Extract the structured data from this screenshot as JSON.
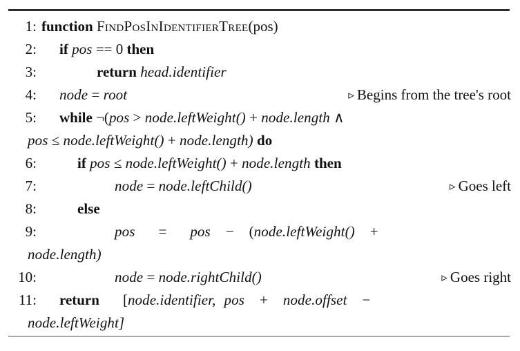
{
  "document": {
    "kind": "algorithm-pseudocode-block",
    "rules": {
      "top": "thick",
      "bottom": "thin"
    }
  },
  "symbols": {
    "comment_marker": "▹",
    "logical_not": "¬",
    "logical_and": "∧",
    "less_equal": "≤",
    "greater": ">",
    "equals": "=",
    "double_equals": "==",
    "plus": "+",
    "minus": "−"
  },
  "lines": [
    {
      "number": "1:",
      "indent": 0,
      "keyword": "function",
      "name": "FindPosInIdentifierTree",
      "args": "(pos)",
      "comment": ""
    },
    {
      "number": "2:",
      "indent": 1,
      "keyword_if": "if",
      "var": "pos",
      "operator": "==",
      "value": "0",
      "keyword_then": "then",
      "comment": ""
    },
    {
      "number": "3:",
      "indent": 2,
      "keyword": "return",
      "expr": "head.identifier",
      "comment": ""
    },
    {
      "number": "4:",
      "indent": 1,
      "lhs": "node",
      "operator": "=",
      "rhs": "root",
      "comment": "Begins from the tree's root"
    },
    {
      "number": "5:",
      "indent": 1,
      "keyword": "while",
      "cond_row1": "¬(pos > node.leftWeight() + node.length ∧",
      "cond_row2": "pos ≤ node.leftWeight() + node.length)",
      "keyword_do": "do",
      "comment": ""
    },
    {
      "number": "6:",
      "indent": 2,
      "keyword_if": "if",
      "cond": "pos ≤ node.leftWeight() + node.length",
      "keyword_then": "then",
      "comment": ""
    },
    {
      "number": "7:",
      "indent": 3,
      "lhs": "node",
      "operator": "=",
      "rhs": "node.leftChild()",
      "comment": "Goes left"
    },
    {
      "number": "8:",
      "indent": 2,
      "keyword": "else",
      "comment": ""
    },
    {
      "number": "9:",
      "indent": 3,
      "lhs": "pos",
      "operator": "=",
      "rhs_row1": "pos − (node.leftWeight() +",
      "rhs_row2": "node.length)",
      "comment": ""
    },
    {
      "number": "10:",
      "indent": 3,
      "lhs": "node",
      "operator": "=",
      "rhs": "node.rightChild()",
      "comment": "Goes right"
    },
    {
      "number": "11:",
      "indent": 1,
      "keyword": "return",
      "expr_row1": "[node.identifier, pos + node.offset −",
      "expr_row2": "node.leftWeight]",
      "comment": ""
    }
  ],
  "tokens": {
    "l1_keyword": "function",
    "l1_name": "FindPosInIdentifierTree",
    "l1_args": "(pos)",
    "l2_if": "if",
    "l2_pos": "pos",
    "l2_eqeq": "==",
    "l2_zero": "0",
    "l2_then": "then",
    "l3_return": "return",
    "l3_expr": "head.identifier",
    "l4_node": "node",
    "l4_eq": "=",
    "l4_root": "root",
    "l4_tri": "▹",
    "l4_comment": "Begins from the tree's root",
    "l5_while": "while",
    "l5_not": "¬(",
    "l5_pos": "pos",
    "l5_gt": ">",
    "l5_lw": "node.leftWeight()",
    "l5_plus": "+",
    "l5_len": "node.length",
    "l5_and": "∧",
    "l5_pos2": "pos",
    "l5_le": "≤",
    "l5_lw2": "node.leftWeight()",
    "l5_plus2": "+",
    "l5_len2": "node.length)",
    "l5_do": "do",
    "l6_if": "if",
    "l6_pos": "pos",
    "l6_le": "≤",
    "l6_lw": "node.leftWeight()",
    "l6_plus": "+",
    "l6_len": "node.length",
    "l6_then": "then",
    "l7_node": "node",
    "l7_eq": "=",
    "l7_call": "node.leftChild()",
    "l7_tri": "▹",
    "l7_comment": "Goes left",
    "l8_else": "else",
    "l9_pos": "pos",
    "l9_eq": "=",
    "l9_pos2": "pos",
    "l9_minus": "−",
    "l9_open": "(",
    "l9_lw": "node.leftWeight()",
    "l9_plus": "+",
    "l9_len": "node.length)",
    "l10_node": "node",
    "l10_eq": "=",
    "l10_call": "node.rightChild()",
    "l10_tri": "▹",
    "l10_comment": "Goes right",
    "l11_return": "return",
    "l11_open": "[",
    "l11_ident": "node.identifier,",
    "l11_pos": "pos",
    "l11_plus": "+",
    "l11_offset": "node.offset",
    "l11_minus": "−",
    "l11_lw": "node.leftWeight]"
  },
  "linenumbers": {
    "n1": "1:",
    "n2": "2:",
    "n3": "3:",
    "n4": "4:",
    "n5": "5:",
    "n6": "6:",
    "n7": "7:",
    "n8": "8:",
    "n9": "9:",
    "n10": "10:",
    "n11": "11:"
  }
}
